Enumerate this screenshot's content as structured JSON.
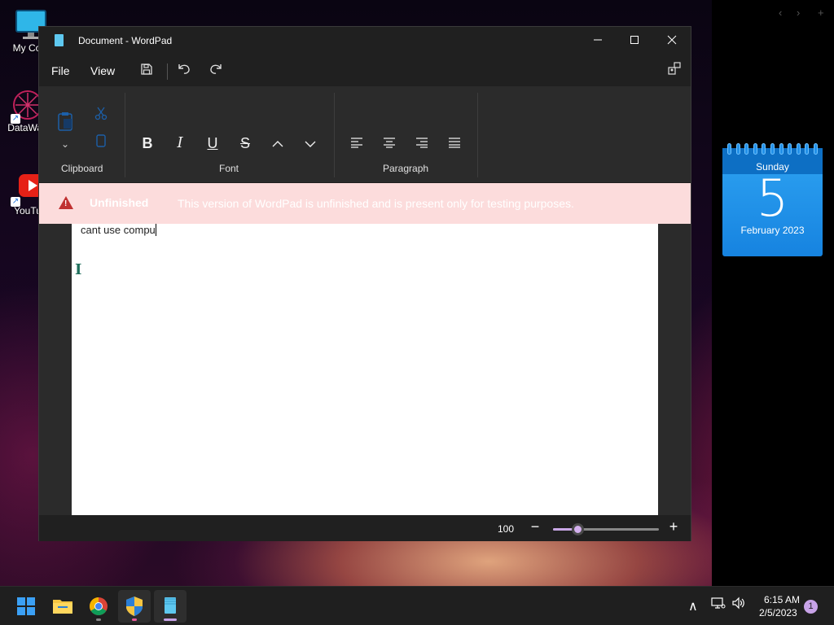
{
  "desktop": {
    "icons": [
      {
        "label": "My Com"
      },
      {
        "label": "DataWag"
      },
      {
        "label": "YouTu"
      }
    ],
    "top_controls": [
      "‹",
      "›",
      "+"
    ]
  },
  "calendar_widget": {
    "weekday": "Sunday",
    "day": "5",
    "month_year": "February 2023"
  },
  "window": {
    "title": "Document - WordPad",
    "menu": {
      "file": "File",
      "view": "View"
    },
    "ribbon": {
      "groups": {
        "clipboard": "Clipboard",
        "font": "Font",
        "paragraph": "Paragraph"
      },
      "font_buttons": {
        "bold": "B",
        "italic": "I",
        "underline": "U",
        "strike": "S"
      }
    },
    "banner": {
      "title": "Unfinished",
      "message": "This version of WordPad is unfinished and is present only for testing purposes."
    },
    "document": {
      "text": "cant use compu"
    },
    "status": {
      "zoom": "100",
      "zoom_fraction": 0.23
    }
  },
  "taskbar": {
    "clock_time": "6:15 AM",
    "clock_date": "2/5/2023",
    "notification_count": "1"
  },
  "colors": {
    "accent": "#c8a3e8",
    "banner_bg": "#fcdcdc",
    "warning": "#c03030",
    "calendar": "#1683e0"
  }
}
